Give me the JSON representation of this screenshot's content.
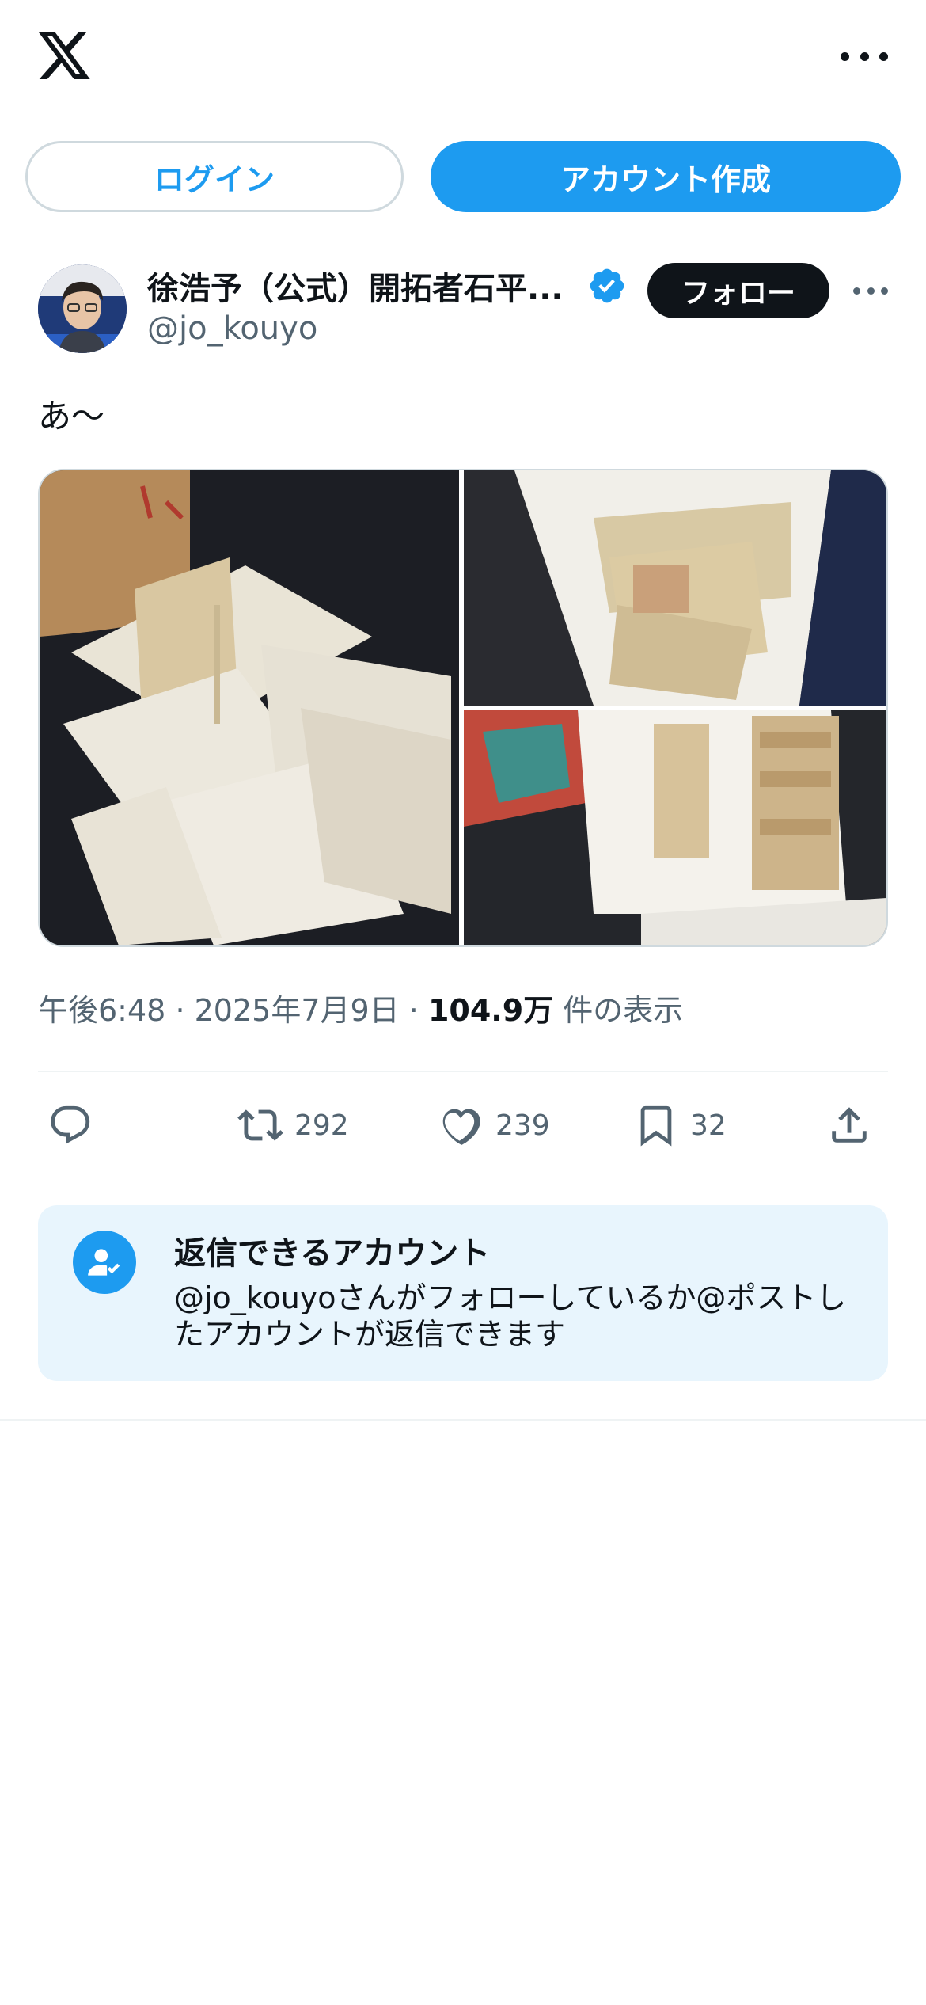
{
  "header": {
    "logo": "x-logo-icon",
    "more": "more-horizontal-icon"
  },
  "auth": {
    "login_label": "ログイン",
    "signup_label": "アカウント作成"
  },
  "tweet": {
    "author_name": "徐浩予（公式）開拓者石平...",
    "handle": "@jo_kouyo",
    "verified": true,
    "follow_label": "フォロー",
    "text": "あ〜",
    "time": "午後6:48",
    "date": "2025年7月9日",
    "views_count": "104.9万",
    "views_label": "件の表示",
    "separator": "·",
    "media_count": 3
  },
  "actions": {
    "reply_count": "",
    "retweet_count": "292",
    "like_count": "239",
    "bookmark_count": "32"
  },
  "reply_settings": {
    "title": "返信できるアカウント",
    "body": "@jo_kouyoさんがフォローしているか@ポストしたアカウントが返信できます"
  },
  "colors": {
    "accent": "#1d9bf0",
    "text": "#0f1419",
    "muted": "#536471",
    "card_bg": "#e8f5fd"
  }
}
